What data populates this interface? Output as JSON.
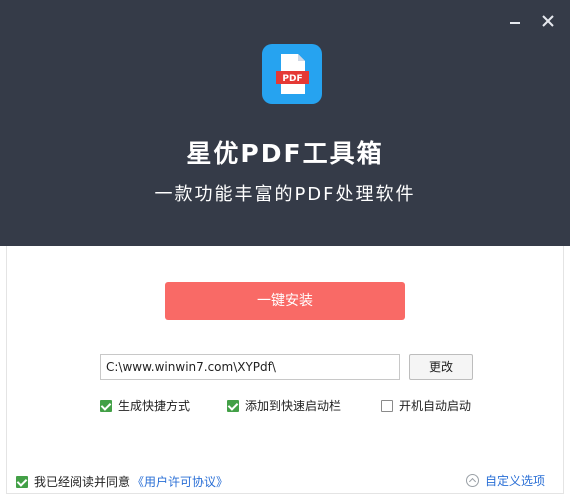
{
  "window": {
    "title": "星优PDF工具箱",
    "subtitle": "一款功能丰富的PDF处理软件",
    "minimize_icon": "minimize-icon",
    "close_icon": "close-icon"
  },
  "app_icon": {
    "name": "pdf-file-icon",
    "label": "PDF",
    "bg_color": "#26a3f0"
  },
  "install": {
    "button_label": "一键安装",
    "button_color": "#f96a66"
  },
  "path": {
    "value": "C:\\www.winwin7.com\\XYPdf\\",
    "change_label": "更改"
  },
  "options": [
    {
      "label": "生成快捷方式",
      "checked": true
    },
    {
      "label": "添加到快速启动栏",
      "checked": true
    },
    {
      "label": "开机自动启动",
      "checked": false
    }
  ],
  "footer": {
    "agree_text": "我已经阅读并同意",
    "agree_checked": true,
    "license_link": "《用户许可协议》",
    "custom_options": "自定义选项"
  },
  "colors": {
    "header_bg": "#353b48",
    "check_green": "#43a047",
    "link_blue": "#2a6fd6"
  }
}
